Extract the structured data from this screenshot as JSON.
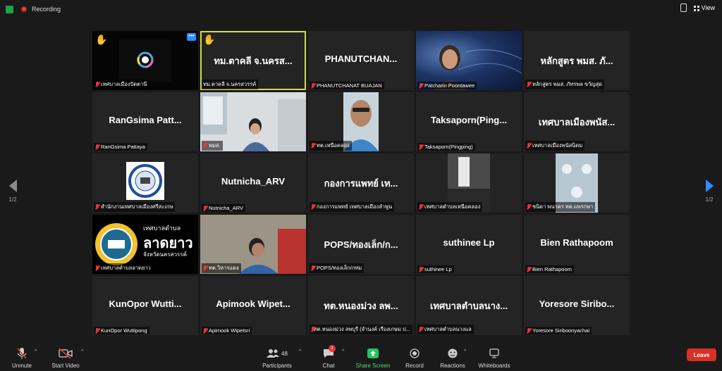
{
  "topbar": {
    "recording_label": "Recording",
    "view_label": "View"
  },
  "pager": {
    "left": "1/2",
    "right": "1/2"
  },
  "tiles": [
    {
      "big": "",
      "name": "เทศบาลเมืองปัตตานี"
    },
    {
      "big": "ทม.ตาคลี จ.นครส...",
      "name": "ทม.ตาคลี จ.นครสวรรค์"
    },
    {
      "big": "PHANUTCHAN...",
      "name": "PHANUTCHANAT BUAJAN"
    },
    {
      "big": "",
      "name": "Patcharin Poontawee"
    },
    {
      "big": "หลักสูตร พมส. ภั...",
      "name": "หลักสูตร พมส. ภัทรพล ขวัญสุด"
    },
    {
      "big": "RanGsima  Patt...",
      "name": "RanGsima  Pattaya"
    },
    {
      "big": "",
      "name": "พมส."
    },
    {
      "big": "",
      "name": "ทต.เหนือคลอง"
    },
    {
      "big": "Taksaporn(Ping...",
      "name": "Taksaporn(Pingping)"
    },
    {
      "big": "เทศบาลเมืองพนัส...",
      "name": "เทศบาลเมืองพนัสนิคม"
    },
    {
      "big": "",
      "name": "สำนักงานเทศบาลเมืองศรีสะเกษ"
    },
    {
      "big": "Nutnicha_ARV",
      "name": "Nutnicha_ARV"
    },
    {
      "big": "กองการแพทย์ เท...",
      "name": "กองการแพทย์ เทศบาลเมืองลำพูน"
    },
    {
      "big": "",
      "name": "เทศบาลตำบลเหนือคลอง"
    },
    {
      "big": "",
      "name": "ชนิดา พนาคร ทต.แพรกษา"
    },
    {
      "big": "",
      "name": "เทศบาลตำบลลาดยาว"
    },
    {
      "big": "",
      "name": "ทต.วิหารแดง"
    },
    {
      "big": "POPS/ทองเล็ก/ก...",
      "name": "POPS/ทองเล็ก/กทม"
    },
    {
      "big": "suthinee Lp",
      "name": "suthinee Lp"
    },
    {
      "big": "Bien Rathapoom",
      "name": "Bien Rathapoom"
    },
    {
      "big": "KunOpor  Wutti...",
      "name": "KunOpor Wuttipong"
    },
    {
      "big": "Apimook  Wipet...",
      "name": "Apimook Wipetsri"
    },
    {
      "big": "ทต.หนองม่วง ลพ...",
      "name": "ทต.หนองม่วง ลพบุรี (จำนงค์ เรืองเกษม ป..."
    },
    {
      "big": "เทศบาลตำบลนาง...",
      "name": "เทศบาลตำบลนางแล"
    },
    {
      "big": "Yoresore  Siribo...",
      "name": "Yoresore Siriboonyachai"
    }
  ],
  "logo_text": {
    "line1": "เทศบาลตำบล",
    "line2": "ลาดยาว",
    "line3": "จังหวัดนครสวรรค์"
  },
  "toolbar": {
    "unmute": "Unmute",
    "start_video": "Start Video",
    "participants": "Participants",
    "participants_count": "48",
    "chat": "Chat",
    "chat_badge": "1",
    "share_screen": "Share Screen",
    "record": "Record",
    "reactions": "Reactions",
    "whiteboards": "Whiteboards",
    "leave": "Leave"
  },
  "colors": {
    "accent": "#2d8cff",
    "share": "#22c55e",
    "leave": "#d93025",
    "active_speaker": "#cddc4a",
    "muted": "#e33333"
  }
}
